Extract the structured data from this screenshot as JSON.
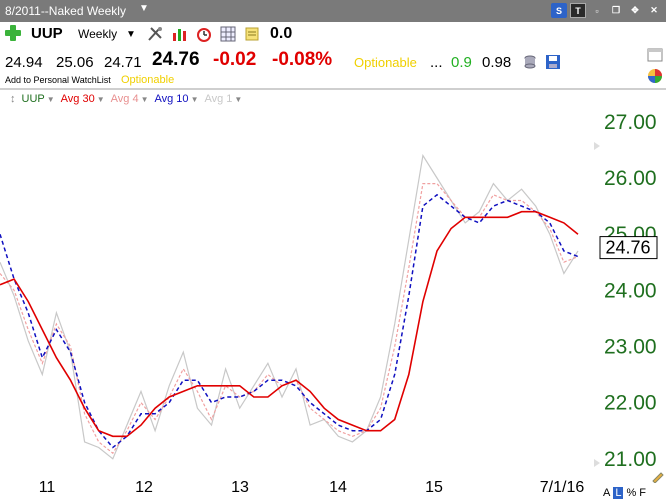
{
  "window": {
    "title": "8/2011--Naked Weekly"
  },
  "toolbar": {
    "symbol": "UUP",
    "period": "Weekly",
    "value": "0.0",
    "s_label": "S",
    "t_label": "T"
  },
  "quote": {
    "open": "24.94",
    "high": "25.06",
    "low": "24.71",
    "last": "24.76",
    "change": "-0.02",
    "pct_change": "-0.08%",
    "optionable": "Optionable",
    "dots": "...",
    "beta": "0.9",
    "ratio": "0.98"
  },
  "watchlist": {
    "label": "Add to Personal WatchList",
    "optionable": "Optionable"
  },
  "legend": {
    "symbol": "UUP",
    "avg30": "Avg 30",
    "avg4": "Avg 4",
    "avg10": "Avg 10",
    "avg1": "Avg 1"
  },
  "colors": {
    "avg30": "#e00000",
    "avg4": "#f0a0a0",
    "avg10": "#1010c0",
    "avg1": "#c8c8c8",
    "axis_green": "#1f6f1f"
  },
  "chart_data": {
    "type": "line",
    "ylim": [
      20.8,
      27.3
    ],
    "y_ticks": [
      "27.00",
      "26.00",
      "25.00",
      "24.00",
      "23.00",
      "22.00",
      "21.00"
    ],
    "y_tick_values": [
      27,
      26,
      25,
      24,
      23,
      22,
      21
    ],
    "x_labels": [
      "11",
      "12",
      "13",
      "14",
      "15",
      "7/1/16"
    ],
    "last_label": "24.76",
    "series": [
      {
        "name": "Avg 1",
        "values": [
          24.5,
          23.9,
          23.1,
          22.5,
          23.6,
          22.9,
          21.3,
          21.2,
          21.0,
          21.6,
          22.2,
          21.5,
          22.3,
          22.9,
          21.9,
          21.6,
          22.6,
          21.9,
          22.3,
          22.7,
          22.1,
          22.6,
          21.6,
          21.7,
          21.4,
          21.3,
          21.5,
          22.1,
          23.4,
          24.9,
          26.4,
          26.0,
          25.6,
          25.2,
          25.4,
          25.9,
          25.6,
          25.8,
          25.5,
          25.0,
          24.3,
          24.7
        ]
      },
      {
        "name": "Avg 4",
        "values": [
          24.3,
          24.0,
          23.3,
          22.7,
          23.4,
          23.0,
          21.8,
          21.3,
          21.1,
          21.5,
          22.0,
          21.7,
          22.1,
          22.6,
          22.2,
          21.7,
          22.3,
          22.1,
          22.2,
          22.5,
          22.3,
          22.4,
          21.9,
          21.7,
          21.5,
          21.4,
          21.5,
          21.9,
          23.0,
          24.4,
          25.9,
          25.9,
          25.6,
          25.3,
          25.3,
          25.7,
          25.6,
          25.6,
          25.4,
          25.1,
          24.5,
          24.6
        ]
      },
      {
        "name": "Avg 10",
        "values": [
          25.0,
          24.2,
          23.6,
          22.8,
          23.3,
          22.9,
          22.0,
          21.5,
          21.2,
          21.4,
          21.8,
          21.8,
          22.0,
          22.4,
          22.4,
          22.0,
          22.1,
          22.1,
          22.2,
          22.4,
          22.4,
          22.3,
          22.0,
          21.8,
          21.6,
          21.5,
          21.5,
          21.7,
          22.5,
          23.9,
          25.5,
          25.7,
          25.5,
          25.3,
          25.2,
          25.5,
          25.6,
          25.5,
          25.4,
          25.2,
          24.7,
          24.6
        ]
      },
      {
        "name": "Avg 30",
        "values": [
          24.1,
          24.2,
          23.8,
          23.3,
          22.8,
          22.4,
          21.9,
          21.5,
          21.4,
          21.4,
          21.6,
          21.9,
          22.1,
          22.2,
          22.3,
          22.3,
          22.3,
          22.3,
          22.1,
          22.1,
          22.3,
          22.4,
          22.2,
          21.9,
          21.7,
          21.6,
          21.5,
          21.5,
          21.7,
          22.5,
          23.8,
          24.7,
          25.1,
          25.3,
          25.3,
          25.3,
          25.3,
          25.4,
          25.4,
          25.3,
          25.2,
          25.0
        ]
      }
    ]
  },
  "bottom": {
    "a": "A",
    "l": "L",
    "pct": "%",
    "f": "F"
  }
}
